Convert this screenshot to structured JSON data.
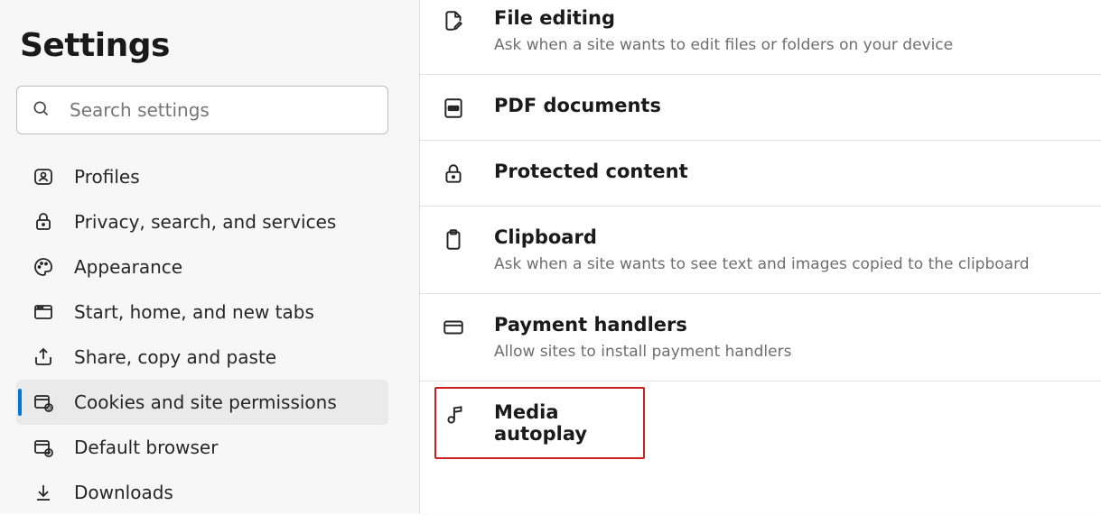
{
  "sidebar": {
    "title": "Settings",
    "search_placeholder": "Search settings",
    "items": [
      {
        "id": "profiles",
        "label": "Profiles"
      },
      {
        "id": "privacy",
        "label": "Privacy, search, and services"
      },
      {
        "id": "appearance",
        "label": "Appearance"
      },
      {
        "id": "start",
        "label": "Start, home, and new tabs"
      },
      {
        "id": "share",
        "label": "Share, copy and paste"
      },
      {
        "id": "cookies",
        "label": "Cookies and site permissions",
        "selected": true
      },
      {
        "id": "default",
        "label": "Default browser"
      },
      {
        "id": "downloads",
        "label": "Downloads"
      }
    ]
  },
  "main": {
    "rows": [
      {
        "id": "file-editing",
        "title": "File editing",
        "sub": "Ask when a site wants to edit files or folders on your device"
      },
      {
        "id": "pdf",
        "title": "PDF documents",
        "sub": ""
      },
      {
        "id": "protected",
        "title": "Protected content",
        "sub": ""
      },
      {
        "id": "clipboard",
        "title": "Clipboard",
        "sub": "Ask when a site wants to see text and images copied to the clipboard"
      },
      {
        "id": "payment",
        "title": "Payment handlers",
        "sub": "Allow sites to install payment handlers"
      },
      {
        "id": "media-autoplay",
        "title": "Media autoplay",
        "sub": "",
        "highlighted": true
      }
    ]
  }
}
